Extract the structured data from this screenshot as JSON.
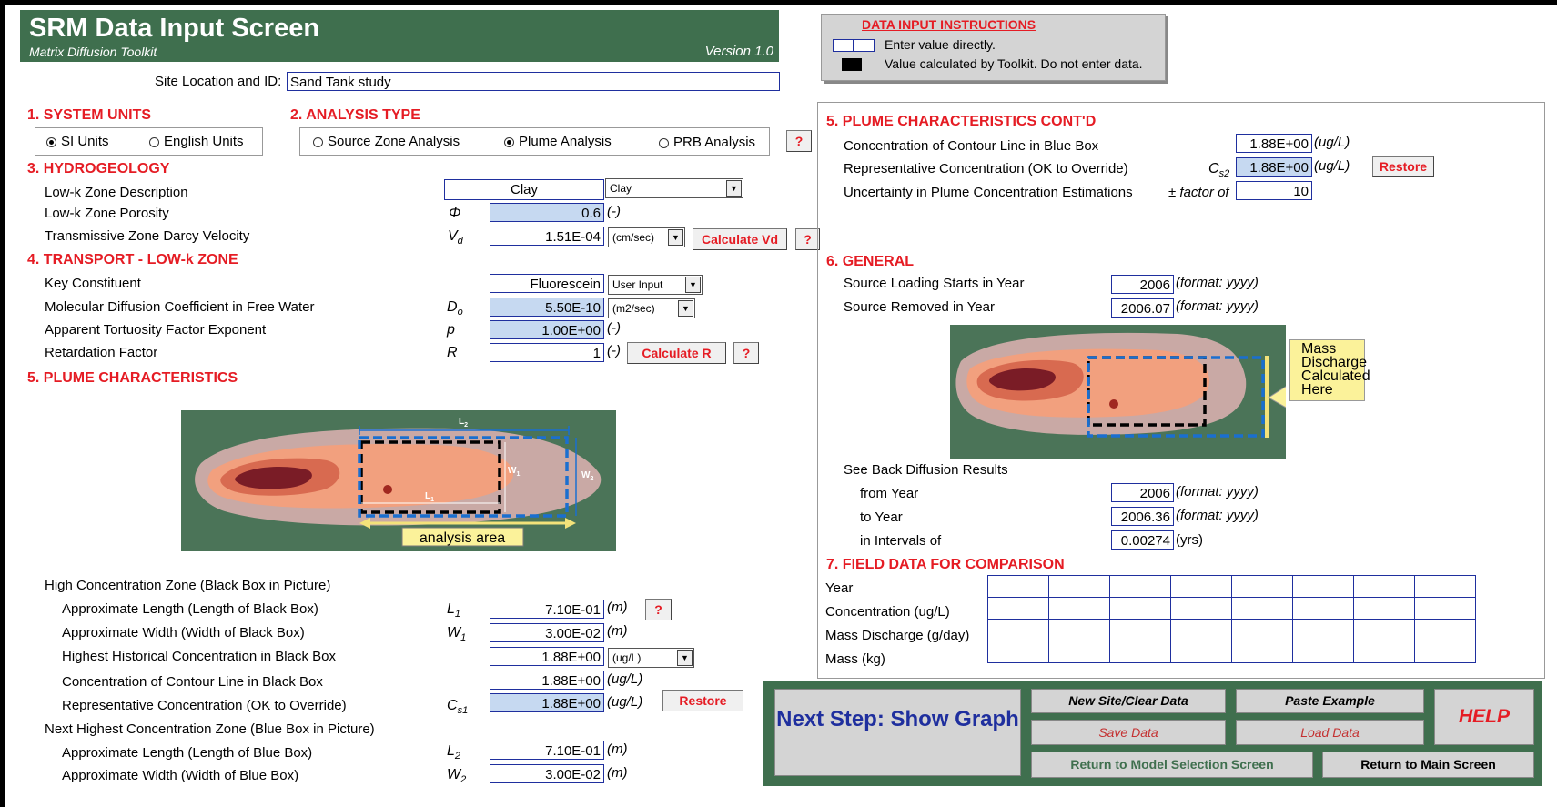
{
  "header": {
    "title": "SRM Data Input Screen",
    "subtitle": "Matrix Diffusion Toolkit",
    "version": "Version 1.0"
  },
  "site": {
    "label": "Site Location and ID:",
    "value": "Sand Tank study"
  },
  "instructions": {
    "title": "DATA  INPUT  INSTRUCTIONS",
    "enter": "Enter value directly.",
    "calc": "Value calculated by Toolkit. Do not enter data."
  },
  "units": {
    "title": "1.  SYSTEM UNITS",
    "si": "SI Units",
    "english": "English Units",
    "selected": "si"
  },
  "analysis": {
    "title": "2.  ANALYSIS TYPE",
    "source": "Source Zone Analysis",
    "plume": "Plume Analysis",
    "prb": "PRB Analysis",
    "help": "?"
  },
  "hydro": {
    "title": "3.  HYDROGEOLOGY",
    "desc_label": "Low-k Zone Description",
    "desc_value": "Clay",
    "desc_option": "Clay",
    "porosity_label": "Low-k Zone Porosity",
    "porosity_sym": "Φ",
    "porosity_value": "0.6",
    "porosity_unit": "(-)",
    "darcy_label": "Transmissive Zone Darcy Velocity",
    "darcy_sym": "V",
    "darcy_sub": "d",
    "darcy_value": "1.51E-04",
    "darcy_unit": "(cm/sec)",
    "calc_vd": "Calculate Vd",
    "help": "?"
  },
  "transport": {
    "title": "4.  TRANSPORT - LOW-k ZONE",
    "constituent_label": "Key Constituent",
    "constituent_value": "Fluorescein",
    "constituent_option": "User Input",
    "diff_label": "Molecular Diffusion Coefficient in Free Water",
    "diff_sym": "D",
    "diff_sub": "o",
    "diff_value": "5.50E-10",
    "diff_unit": "(m2/sec)",
    "tort_label": "Apparent Tortuosity Factor Exponent",
    "tort_sym": "p",
    "tort_value": "1.00E+00",
    "tort_unit": "(-)",
    "retard_label": "Retardation Factor",
    "retard_sym": "R",
    "retard_value": "1",
    "retard_unit": "(-)",
    "calc_r": "Calculate R",
    "help": "?"
  },
  "plume": {
    "title": "5.  PLUME CHARACTERISTICS",
    "diagram": {
      "l2": "L",
      "l2_sub": "2",
      "w1": "W",
      "w1_sub": "1",
      "w2": "W",
      "w2_sub": "2",
      "l1": "L",
      "l1_sub": "1",
      "area": "analysis area"
    },
    "high_title": "High Concentration Zone (Black Box in Picture)",
    "l1_label": "Approximate Length (Length of Black Box)",
    "l1_sym": "L",
    "l1_sub": "1",
    "l1_value": "7.10E-01",
    "l1_unit": "(m)",
    "help": "?",
    "w1_label": "Approximate Width (Width of Black Box)",
    "w1_sym": "W",
    "w1_sub": "1",
    "w1_value": "3.00E-02",
    "w1_unit": "(m)",
    "hist_label": "Highest Historical Concentration in Black Box",
    "hist_value": "1.88E+00",
    "hist_unit": "(ug/L)",
    "contour_label": "Concentration of Contour Line in Black Box",
    "contour_value": "1.88E+00",
    "contour_unit": "(ug/L)",
    "rep_label": "Representative  Concentration (OK  to Override)",
    "rep_sym": "C",
    "rep_sub": "s1",
    "rep_value": "1.88E+00",
    "rep_unit": "(ug/L)",
    "restore": "Restore",
    "next_title": "Next Highest Concentration Zone (Blue Box in Picture)",
    "l2_label": "Approximate Length (Length of Blue Box)",
    "l2_sym": "L",
    "l2_sub": "2",
    "l2_value": "7.10E-01",
    "l2_unit": "(m)",
    "w2_label": "Approximate Width  (Width of Blue Box)",
    "w2_sym": "W",
    "w2_sub": "2",
    "w2_value": "3.00E-02",
    "w2_unit": "(m)"
  },
  "plume2": {
    "title": "5.  PLUME CHARACTERISTICS CONT'D",
    "blue_label": "Concentration of Contour Line in Blue Box",
    "blue_value": "1.88E+00",
    "blue_unit": "(ug/L)",
    "rep_label": "Representative  Concentration (OK  to Override)",
    "rep_sym": "C",
    "rep_sub": "s2",
    "rep_value": "1.88E+00",
    "rep_unit": "(ug/L)",
    "restore": "Restore",
    "unc_label": "Uncertainty in Plume Concentration Estimations",
    "unc_prefix": "± factor of",
    "unc_value": "10"
  },
  "general": {
    "title": "6.  GENERAL",
    "start_label": "Source Loading Starts in Year",
    "start_value": "2006",
    "removed_label": "Source Removed in Year",
    "removed_value": "2006.07",
    "fmt": "(format: yyyy)",
    "diagram_note": "Mass Discharge Calculated Here",
    "results_label": "See Back Diffusion Results",
    "from_label": "from Year",
    "from_value": "2006",
    "to_label": "to Year",
    "to_value": "2006.36",
    "interval_label": "in Intervals of",
    "interval_value": "0.00274",
    "interval_unit": "(yrs)"
  },
  "field": {
    "title": "7.  FIELD DATA FOR COMPARISON",
    "rows": [
      "Year",
      "Concentration (ug/L)",
      "Mass Discharge (g/day)",
      "Mass (kg)"
    ]
  },
  "nav": {
    "next": "Next Step: Show Graph",
    "new_site": "New Site/Clear Data",
    "paste": "Paste Example",
    "help": "HELP",
    "save": "Save Data",
    "load": "Load Data",
    "model_sel": "Return to Model Selection Screen",
    "main": "Return to Main Screen"
  }
}
